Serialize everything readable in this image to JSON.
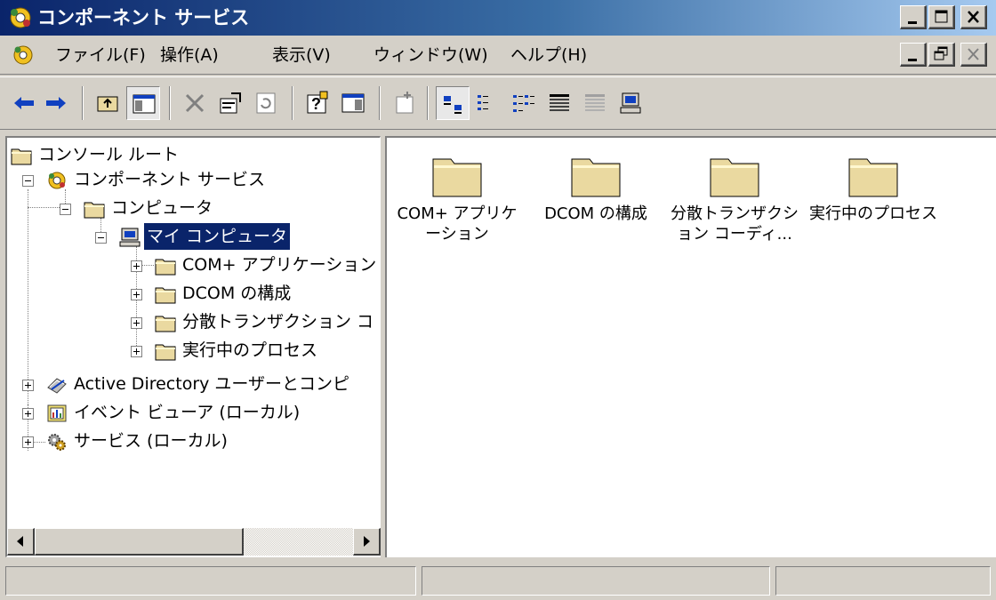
{
  "window": {
    "title": "コンポーネント サービス"
  },
  "menu": [
    {
      "label": "ファイル",
      "key": "(F)"
    },
    {
      "label": "操作",
      "key": "(A)"
    },
    {
      "label": "表示",
      "key": "(V)"
    },
    {
      "label": "ウィンドウ",
      "key": "(W)"
    },
    {
      "label": "ヘルプ",
      "key": "(H)"
    }
  ],
  "toolbar": {
    "buttons": [
      "back",
      "forward",
      "up-one-level",
      "show-hide-console-tree",
      "delete",
      "properties",
      "refresh",
      "help",
      "show-hide-action-pane",
      "new-window",
      "large-icons",
      "small-icons",
      "list",
      "detail",
      "disabled-view",
      "computer"
    ]
  },
  "tree": {
    "nodes": [
      {
        "label": "コンソール ルート",
        "icon": "folder-icon",
        "expander": "none"
      },
      {
        "label": "コンポーネント サービス",
        "icon": "component-services-icon",
        "expander": "minus"
      },
      {
        "label": "コンピュータ",
        "icon": "folder-icon",
        "expander": "minus"
      },
      {
        "label": "マイ コンピュータ",
        "icon": "computer-icon",
        "expander": "minus",
        "selected": true
      },
      {
        "label": "COM+ アプリケーション",
        "icon": "folder-icon",
        "expander": "plus"
      },
      {
        "label": "DCOM の構成",
        "icon": "folder-icon",
        "expander": "plus"
      },
      {
        "label": "分散トランザクション コ",
        "icon": "folder-icon",
        "expander": "plus"
      },
      {
        "label": "実行中のプロセス",
        "icon": "folder-icon",
        "expander": "plus"
      },
      {
        "label": "Active Directory ユーザーとコンピ",
        "icon": "active-directory-icon",
        "expander": "plus"
      },
      {
        "label": "イベント ビューア (ローカル)",
        "icon": "event-viewer-icon",
        "expander": "plus"
      },
      {
        "label": "サービス (ローカル)",
        "icon": "services-icon",
        "expander": "plus"
      }
    ]
  },
  "list": {
    "items": [
      {
        "label": "COM+ アプリケーション",
        "icon": "folder-icon"
      },
      {
        "label": "DCOM の構成",
        "icon": "folder-icon"
      },
      {
        "label": "分散トランザクション コーディ...",
        "icon": "folder-icon"
      },
      {
        "label": "実行中のプロセス",
        "icon": "folder-icon"
      }
    ]
  },
  "status": {
    "panes": [
      "",
      "",
      ""
    ]
  },
  "colors": {
    "titlebar_start": "#0a246a",
    "titlebar_end": "#a6caf0",
    "selection": "#0a246a",
    "chrome": "#d4d0c8",
    "folder": "#ead9a0"
  }
}
